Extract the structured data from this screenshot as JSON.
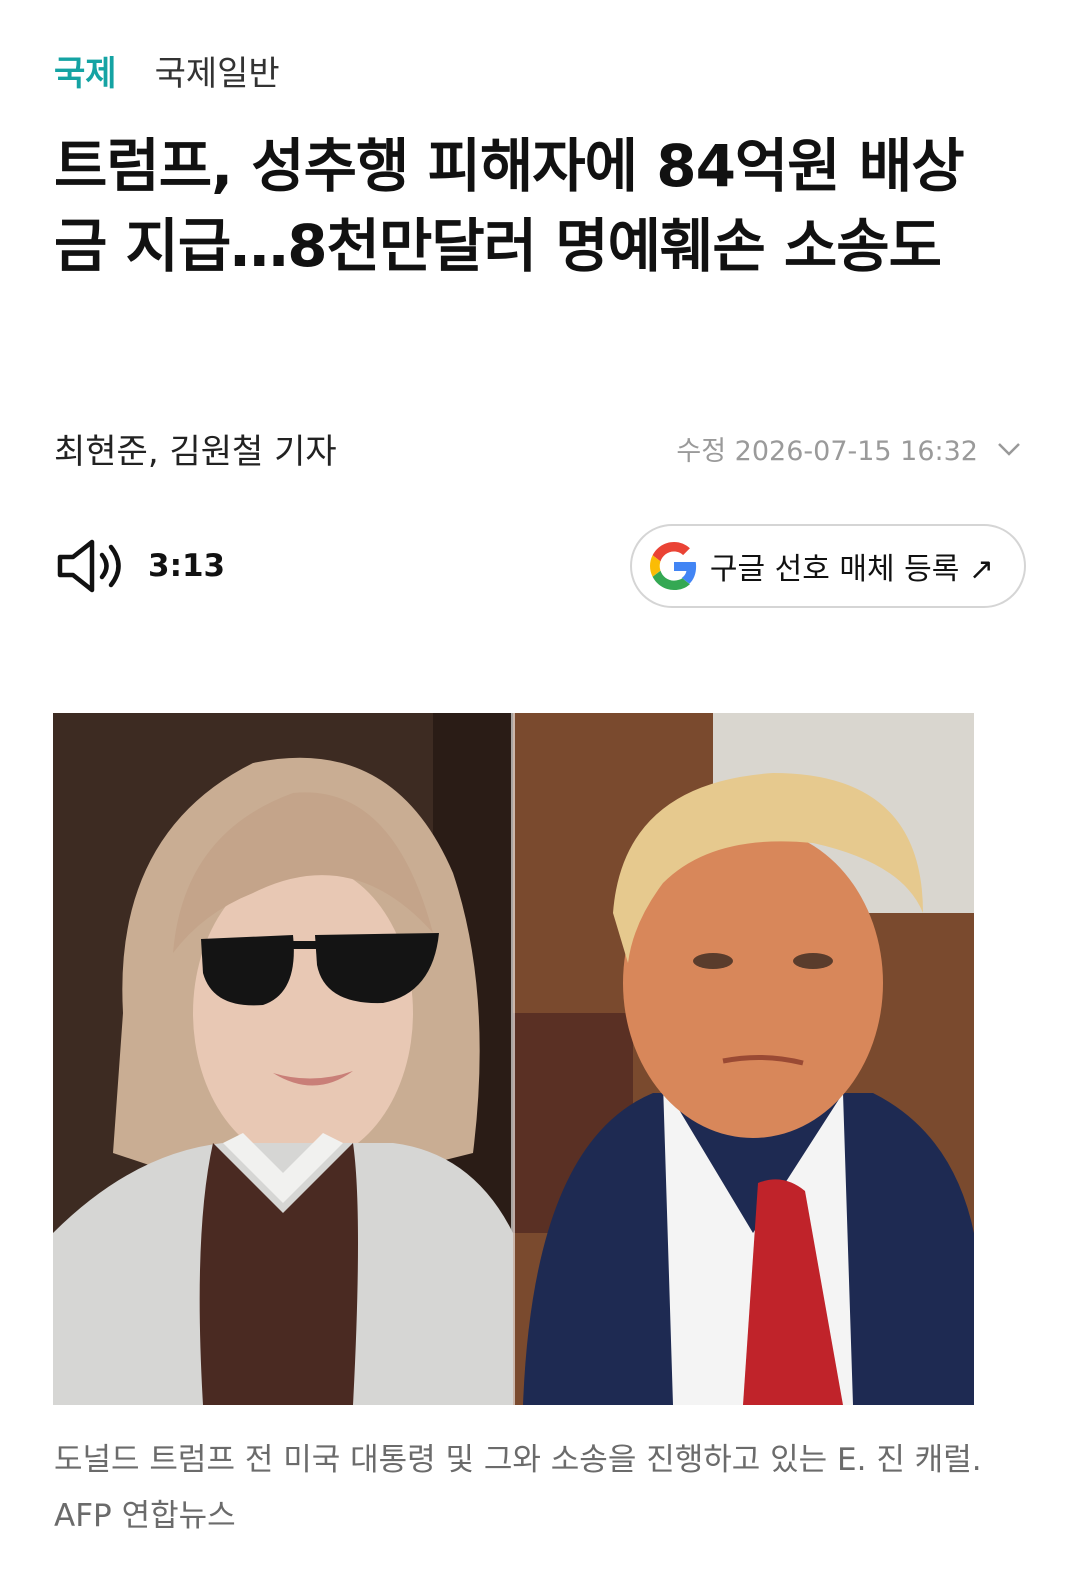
{
  "breadcrumb": {
    "category": "국제",
    "subcategory": "국제일반"
  },
  "article": {
    "title": "트럼프, 성추행 피해자에 84억원 배상금 지급…8천만달러 명예훼손 소송도",
    "byline": "최현준, 김원철 기자",
    "updated": "수정 2026-07-15 16:32"
  },
  "audio": {
    "icon": "speaker-icon",
    "duration": "3:13"
  },
  "google_button": {
    "label": "구글 선호 매체 등록 ↗",
    "icon": "google-logo-icon"
  },
  "photo": {
    "caption": "도널드 트럼프 전 미국 대통령 및 그와 소송을 진행하고 있는 E. 진 캐럴. AFP 연합뉴스"
  },
  "colors": {
    "accent": "#14a3a3",
    "muted": "#9a9a9a",
    "caption": "#6b6b6b"
  }
}
